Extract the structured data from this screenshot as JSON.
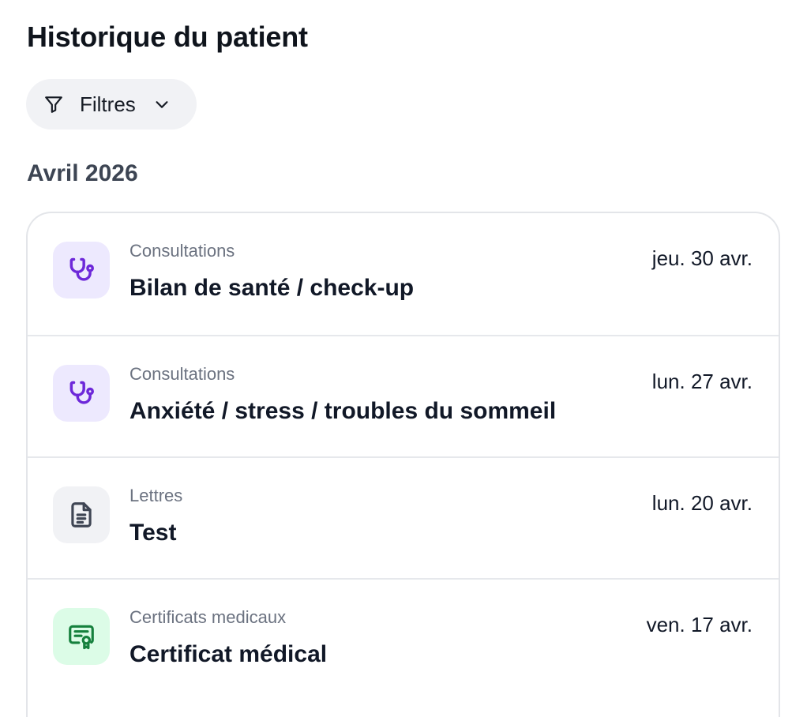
{
  "header": {
    "title": "Historique du patient"
  },
  "filters": {
    "label": "Filtres",
    "icon": "funnel-icon",
    "chevron_icon": "chevron-down-icon"
  },
  "section": {
    "month": "Avril 2026"
  },
  "entries": [
    {
      "category": "Consultations",
      "title": "Bilan de santé / check-up",
      "date": "jeu. 30 avr.",
      "icon": "stethoscope-icon",
      "icon_color": "#6d28d9",
      "tile_color": "#ede9fe"
    },
    {
      "category": "Consultations",
      "title": "Anxiété / stress / troubles du sommeil",
      "date": "lun. 27 avr.",
      "icon": "stethoscope-icon",
      "icon_color": "#6d28d9",
      "tile_color": "#ede9fe"
    },
    {
      "category": "Lettres",
      "title": "Test",
      "date": "lun. 20 avr.",
      "icon": "document-icon",
      "icon_color": "#3f4654",
      "tile_color": "#f1f2f5"
    },
    {
      "category": "Certificats medicaux",
      "title": "Certificat médical",
      "date": "ven. 17 avr.",
      "icon": "certificate-icon",
      "icon_color": "#15803d",
      "tile_color": "#dcfce7"
    }
  ]
}
